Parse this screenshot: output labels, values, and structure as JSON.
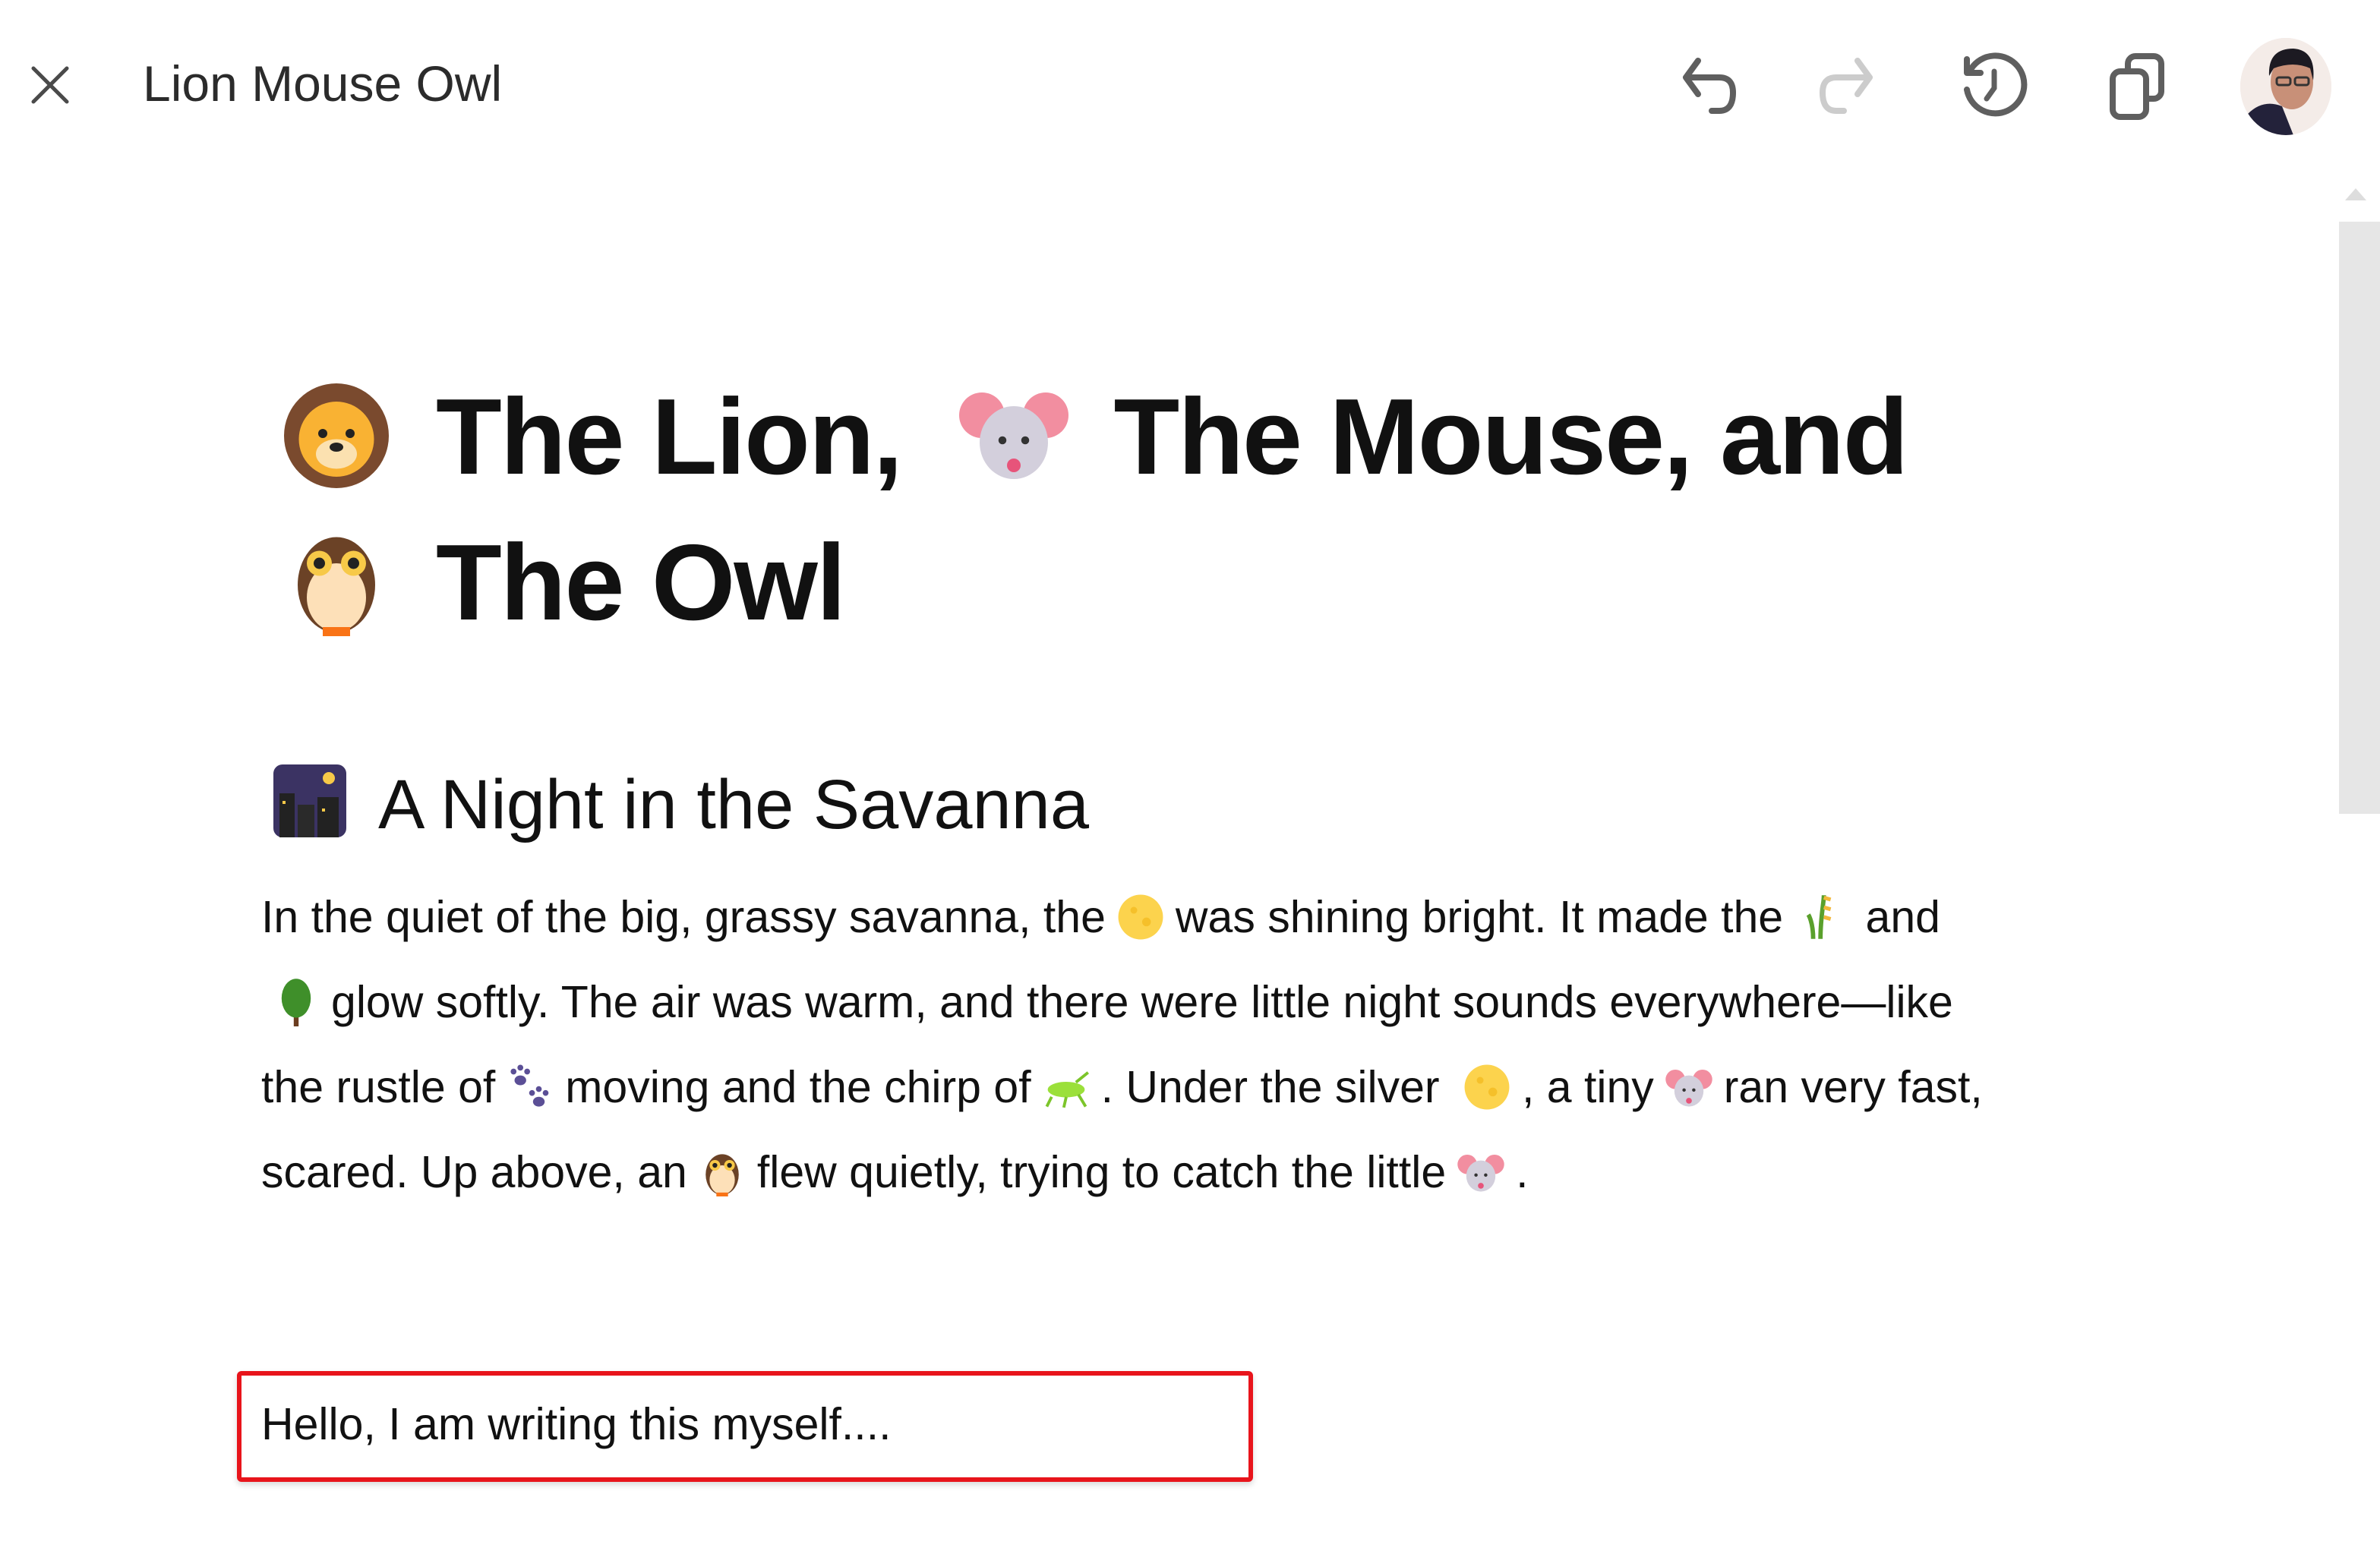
{
  "header": {
    "title": "Lion Mouse Owl",
    "icons": [
      "close-icon",
      "undo-icon",
      "redo-icon",
      "history-icon",
      "copy-icon",
      "user-avatar"
    ],
    "redo_enabled": false
  },
  "document": {
    "title_line1_a": "The Lion,",
    "title_line1_b": "The Mouse, and",
    "title_line2": "The Owl",
    "title_emojis": [
      "lion-face",
      "mouse-face",
      "owl"
    ],
    "section_heading": "A Night in the Savanna",
    "section_emoji": "night-with-stars",
    "paragraph": {
      "segments": [
        "In the quiet of the big, grassy savanna, the",
        "was shining bright. It made the",
        "and",
        "glow softly. The air was warm, and there were little night sounds everywhere—like the rustle of",
        "moving and the chirp of",
        ". Under the silver",
        ", a tiny",
        "ran very fast, scared. Up above, an",
        "flew quietly, trying to catch the little",
        "."
      ],
      "emojis": [
        "full-moon",
        "grass",
        "tree",
        "paw-prints",
        "cricket",
        "full-moon",
        "mouse-face",
        "owl",
        "mouse-face"
      ]
    }
  },
  "editor_input": {
    "value": "Hello, I am writing this myself....",
    "border_color": "#e8141b"
  },
  "colors": {
    "icon": "#5f5f5f",
    "icon_disabled": "#cccccc",
    "scrollbar": "#e6e6e6"
  }
}
